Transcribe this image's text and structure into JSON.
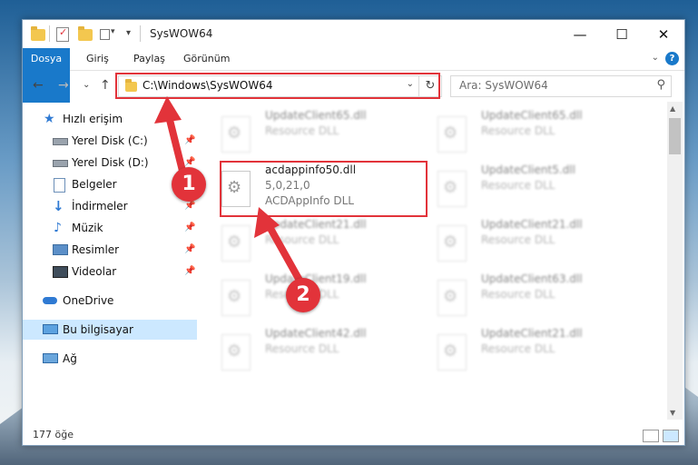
{
  "window": {
    "title": "SysWOW64",
    "minimize_glyph": "—",
    "maximize_glyph": "☐",
    "close_glyph": "✕"
  },
  "ribbon": {
    "tabs": [
      "Dosya",
      "Giriş",
      "Paylaş",
      "Görünüm"
    ],
    "help_glyph": "?",
    "collapse_glyph": "⌄"
  },
  "nav": {
    "back_glyph": "←",
    "forward_glyph": "→",
    "recent_glyph": "⌄",
    "up_glyph": "↑",
    "address": "C:\\Windows\\SysWOW64",
    "dropdown_glyph": "⌄",
    "refresh_glyph": "↻",
    "search_placeholder": "Ara: SysWOW64",
    "search_glyph": "⚲"
  },
  "sidebar": {
    "quick_access": "Hızlı erişim",
    "items": [
      {
        "label": "Yerel Disk (C:)",
        "icon": "drive-icon"
      },
      {
        "label": "Yerel Disk (D:)",
        "icon": "drive-icon"
      },
      {
        "label": "Belgeler",
        "icon": "documents-icon"
      },
      {
        "label": "İndirmeler",
        "icon": "downloads-icon"
      },
      {
        "label": "Müzik",
        "icon": "music-icon"
      },
      {
        "label": "Resimler",
        "icon": "pictures-icon"
      },
      {
        "label": "Videolar",
        "icon": "videos-icon"
      }
    ],
    "pin_glyph": "📌",
    "onedrive": "OneDrive",
    "this_pc": "Bu bilgisayar",
    "network": "Ağ"
  },
  "files": {
    "highlighted": {
      "name": "acdappinfo50.dll",
      "version": "5,0,21,0",
      "desc": "ACDAppInfo DLL"
    },
    "left_column": [
      {
        "name": "UpdateClient65.dll",
        "desc": "Resource DLL"
      },
      {
        "name": "UpdateClient21.dll",
        "desc": "Resource DLL"
      },
      {
        "name": "UpdateClient19.dll",
        "desc": "Resource DLL"
      },
      {
        "name": "UpdateClient42.dll",
        "desc": "Resource DLL"
      }
    ],
    "right_column": [
      {
        "name": "UpdateClient65.dll",
        "desc": "Resource DLL"
      },
      {
        "name": "UpdateClient5.dll",
        "desc": "Resource DLL"
      },
      {
        "name": "UpdateClient21.dll",
        "desc": "Resource DLL"
      },
      {
        "name": "UpdateClient63.dll",
        "desc": "Resource DLL"
      },
      {
        "name": "UpdateClient21.dll",
        "desc": "Resource DLL"
      }
    ]
  },
  "status": {
    "count": "177 öğe"
  },
  "annotations": {
    "step1": "1",
    "step2": "2",
    "color": "#e2333a"
  }
}
